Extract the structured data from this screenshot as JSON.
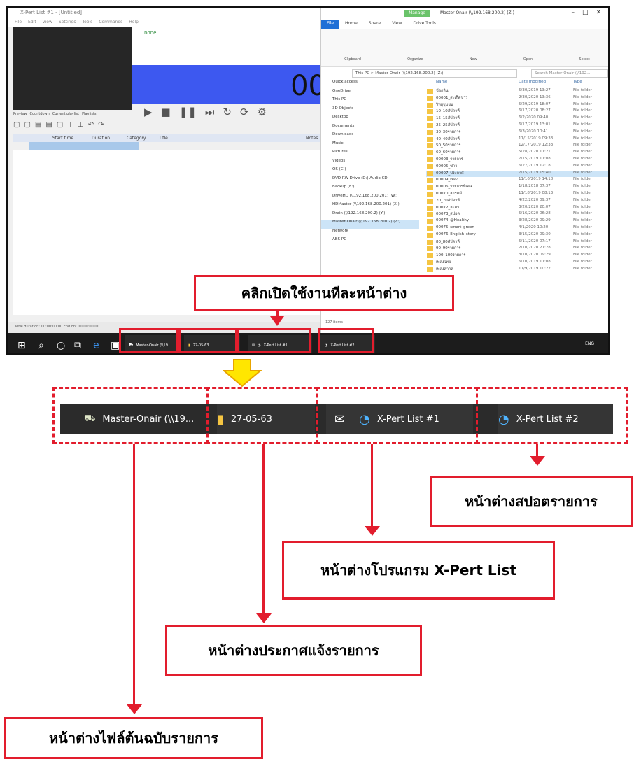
{
  "xpert": {
    "title": "X-Pert List #1 - [Untitled]",
    "menu": [
      "File",
      "Edit",
      "View",
      "Settings",
      "Tools",
      "Commands",
      "Help"
    ],
    "name": "none",
    "timer": "00",
    "tabs": [
      "Preview",
      "Countdown",
      "Current playlist",
      "Playlists"
    ],
    "columns": [
      "Start time",
      "Duration",
      "Category",
      "Title",
      "Notes"
    ],
    "status": "Total duration: 00:00:00:00        End on: 00:00:00:00"
  },
  "explorer": {
    "manage": "Manage",
    "title": "Master-Onair (\\\\192.168.200.2) (Z:)",
    "tabs": [
      "File",
      "Home",
      "Share",
      "View",
      "Drive Tools"
    ],
    "ribbon_groups": [
      "Clipboard",
      "Organize",
      "New",
      "Open",
      "Select"
    ],
    "address": "This PC  >  Master-Onair (\\\\192.168.200.2) (Z:)",
    "search": "Search Master-Onair (\\\\192....",
    "nav": [
      "Quick access",
      "OneDrive",
      "This PC",
      "3D Objects",
      "Desktop",
      "Documents",
      "Downloads",
      "Music",
      "Pictures",
      "Videos",
      "OS (C:)",
      "DVD RW Drive (D:) Audio CD",
      "Backup (E:)",
      "DriveHD (\\\\192.168.200.201) (W:)",
      "HDMaster (\\\\192.168.200.201) (X:)",
      "Drain (\\\\192.168.200.2) (Y:)",
      "Master-Onair (\\\\192.168.200.2) (Z:)",
      "Network",
      "ABS-PC"
    ],
    "file_columns": [
      "Name",
      "Date modified",
      "Type"
    ],
    "files": [
      {
        "name": "ข้อกลิ่น",
        "date": "5/30/2019 13:27",
        "type": "File folder"
      },
      {
        "name": "00001_สะเก็ดข่าว",
        "date": "2/30/2020 13:36",
        "type": "File folder"
      },
      {
        "name": "วิทยุชุมชน",
        "date": "5/29/2019 18:07",
        "type": "File folder"
      },
      {
        "name": "10_10สัปดาห์",
        "date": "6/17/2020 08:27",
        "type": "File folder"
      },
      {
        "name": "15_15สัปดาห์",
        "date": "6/2/2020 09:40",
        "type": "File folder"
      },
      {
        "name": "25_25สัปดาห์",
        "date": "6/17/2019 13:01",
        "type": "File folder"
      },
      {
        "name": "30_30รายการ",
        "date": "6/3/2020 10:41",
        "type": "File folder"
      },
      {
        "name": "40_40สัปดาห์",
        "date": "11/15/2019 09:33",
        "type": "File folder"
      },
      {
        "name": "50_50รายการ",
        "date": "12/17/2019 12:33",
        "type": "File folder"
      },
      {
        "name": "60_60รายการ",
        "date": "5/28/2020 11:21",
        "type": "File folder"
      },
      {
        "name": "00003_รายการ",
        "date": "7/15/2019 11:08",
        "type": "File folder"
      },
      {
        "name": "00005_ข่าว",
        "date": "6/27/2019 12:18",
        "type": "File folder"
      },
      {
        "name": "00007_ประกาศ",
        "date": "7/15/2019 15:40",
        "type": "File folder"
      },
      {
        "name": "00009_เพลง",
        "date": "11/16/2019 14:18",
        "type": "File folder"
      },
      {
        "name": "00006_รายการพิเศษ",
        "date": "1/18/2018 07:37",
        "type": "File folder"
      },
      {
        "name": "00070_สารคดี",
        "date": "11/18/2019 08:13",
        "type": "File folder"
      },
      {
        "name": "70_70สัปดาห์",
        "date": "4/22/2020 09:37",
        "type": "File folder"
      },
      {
        "name": "00072_ละคร",
        "date": "3/20/2020 20:07",
        "type": "File folder"
      },
      {
        "name": "00073_สปอต",
        "date": "5/16/2020 06:28",
        "type": "File folder"
      },
      {
        "name": "00074_@Healthy",
        "date": "3/28/2020 09:29",
        "type": "File folder"
      },
      {
        "name": "00075_smart_green",
        "date": "4/1/2020 10:20",
        "type": "File folder"
      },
      {
        "name": "00076_English_story",
        "date": "3/15/2020 09:30",
        "type": "File folder"
      },
      {
        "name": "80_80สัปดาห์",
        "date": "5/11/2020 07:17",
        "type": "File folder"
      },
      {
        "name": "90_90รายการ",
        "date": "2/10/2020 21:28",
        "type": "File folder"
      },
      {
        "name": "100_100รายการ",
        "date": "3/10/2020 09:29",
        "type": "File folder"
      },
      {
        "name": "เพลงไทย",
        "date": "6/10/2019 11:08",
        "type": "File folder"
      },
      {
        "name": "เพลงสากล",
        "date": "11/9/2019 10:22",
        "type": "File folder"
      }
    ],
    "status": "127 items"
  },
  "taskbar": {
    "buttons": [
      "Master-Onair (\\\\19...",
      "27-05-63",
      "X-Pert List #1",
      "X-Pert List #2"
    ],
    "tray": "ENG"
  },
  "callouts": {
    "top": "คลิกเปิดใช้งานทีละหน้าต่าง",
    "spot": "หน้าต่างสปอตรายการ",
    "xpert": "หน้าต่างโปรแกรม X-Pert List",
    "announce": "หน้าต่างประกาศแจ้งรายการ",
    "source": "หน้าต่างไฟล์ต้นฉบับรายการ"
  },
  "zoom": {
    "master": "Master-Onair (\\\\19...",
    "folder": "27-05-63",
    "xp1": "X-Pert List #1",
    "xp2": "X-Pert List #2"
  },
  "colors": {
    "accent_red": "#e21d2d",
    "arrow_yellow": "#ffe600",
    "timer_blue": "#3d58f0"
  }
}
